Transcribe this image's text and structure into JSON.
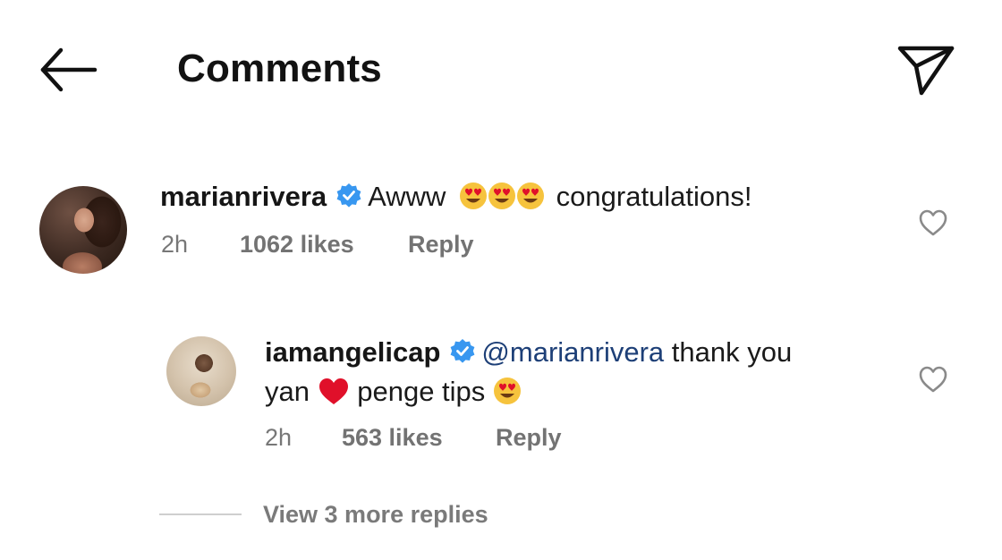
{
  "header": {
    "title": "Comments",
    "back_icon": "arrow-left-icon",
    "send_icon": "paper-plane-icon"
  },
  "comments": [
    {
      "username": "marianrivera",
      "verified": true,
      "text_before": "Awww",
      "emojis": [
        "heart-eyes",
        "heart-eyes",
        "heart-eyes"
      ],
      "text_after": "congratulations!",
      "time": "2h",
      "likes": "1062 likes",
      "reply_label": "Reply"
    }
  ],
  "reply": {
    "username": "iamangelicap",
    "verified": true,
    "mention": "@marianrivera",
    "text_line1_rest": "thank you",
    "text_line2_a": "yan",
    "text_line2_b": "penge tips",
    "time": "2h",
    "likes": "563 likes",
    "reply_label": "Reply"
  },
  "view_more_replies": "View 3 more replies",
  "colors": {
    "verified_blue": "#3897f0",
    "mention": "#1d3f77",
    "meta_gray": "#737373",
    "heart_red": "#e0102a"
  }
}
